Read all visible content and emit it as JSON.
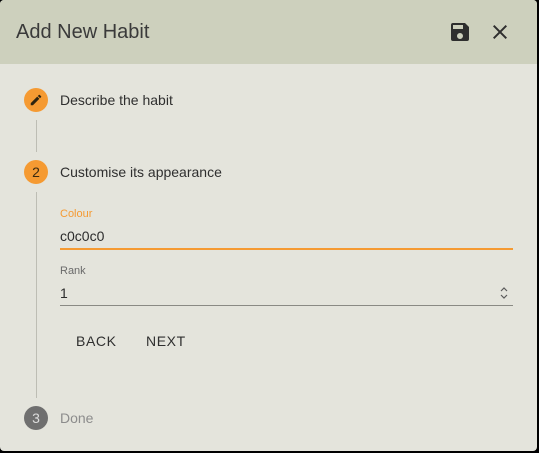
{
  "dialog": {
    "title": "Add New Habit",
    "save_icon": "floppy-disk-icon",
    "close_icon": "close-icon"
  },
  "steps": [
    {
      "number": "",
      "icon": "pencil-icon",
      "label": "Describe the habit",
      "state": "completed"
    },
    {
      "number": "2",
      "label": "Customise its appearance",
      "state": "active"
    },
    {
      "number": "3",
      "label": "Done",
      "state": "inactive"
    }
  ],
  "form": {
    "colour": {
      "label": "Colour",
      "value": "c0c0c0"
    },
    "rank": {
      "label": "Rank",
      "value": "1"
    }
  },
  "buttons": {
    "back": "BACK",
    "next": "NEXT"
  },
  "colors": {
    "accent": "#f59a32",
    "titlebar": "#cdd0bd",
    "background": "#e4e4dc",
    "inactive_step": "#6f6f6f"
  }
}
